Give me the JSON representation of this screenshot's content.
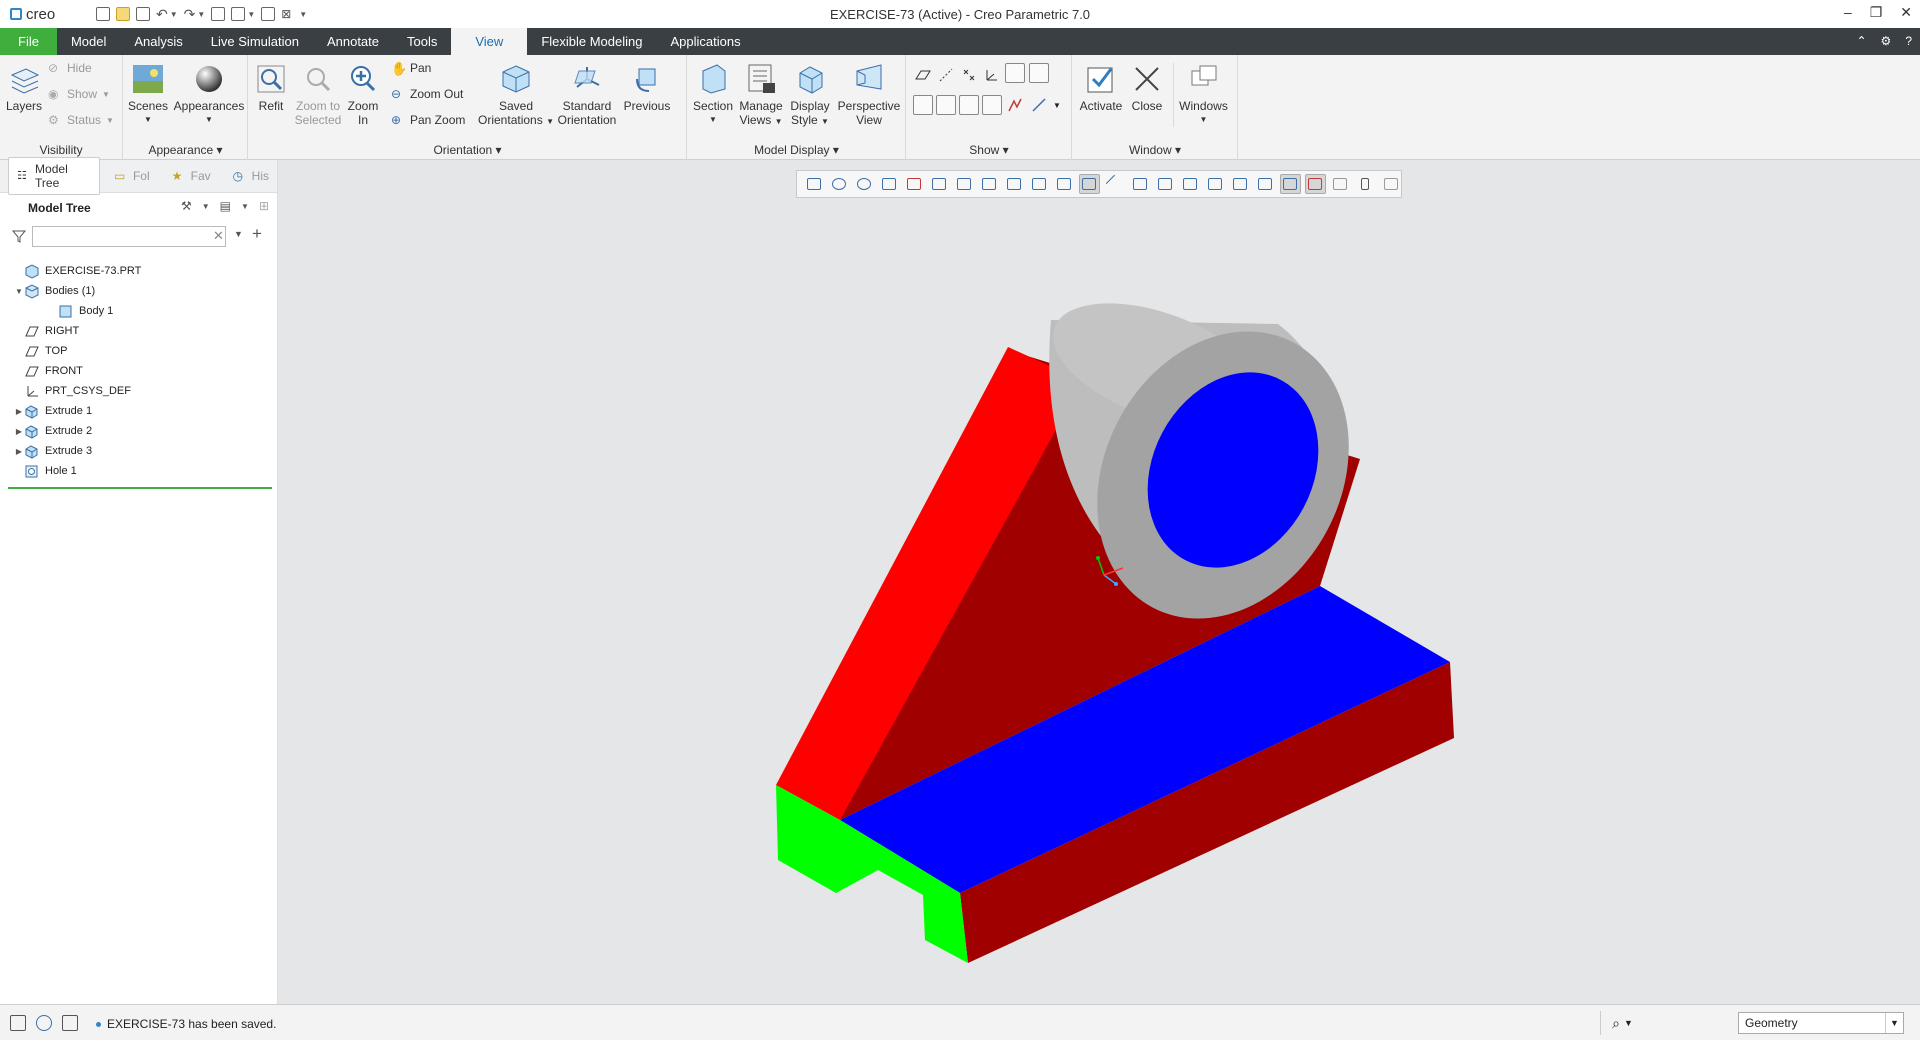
{
  "app": {
    "logo_text": "creo",
    "window_title": "EXERCISE-73 (Active) - Creo Parametric 7.0"
  },
  "menu_tabs": [
    {
      "label": "File"
    },
    {
      "label": "Model"
    },
    {
      "label": "Analysis"
    },
    {
      "label": "Live Simulation"
    },
    {
      "label": "Annotate"
    },
    {
      "label": "Tools"
    },
    {
      "label": "View"
    },
    {
      "label": "Flexible Modeling"
    },
    {
      "label": "Applications"
    }
  ],
  "ribbon": {
    "visibility": {
      "group_label": "Visibility",
      "layers": "Layers",
      "hide": "Hide",
      "show": "Show",
      "status": "Status"
    },
    "appearance": {
      "group_label": "Appearance",
      "scenes": "Scenes",
      "appearances": "Appearances"
    },
    "orientation": {
      "group_label": "Orientation",
      "refit": "Refit",
      "zoom_to_selected_1": "Zoom to",
      "zoom_to_selected_2": "Selected",
      "zoom_in_1": "Zoom",
      "zoom_in_2": "In",
      "pan": "Pan",
      "zoom_out": "Zoom Out",
      "pan_zoom": "Pan Zoom",
      "saved_orientations_1": "Saved",
      "saved_orientations_2": "Orientations",
      "standard_orientation_1": "Standard",
      "standard_orientation_2": "Orientation",
      "previous": "Previous"
    },
    "model_display": {
      "group_label": "Model Display",
      "section": "Section",
      "manage_views_1": "Manage",
      "manage_views_2": "Views",
      "display_style_1": "Display",
      "display_style_2": "Style",
      "perspective_view_1": "Perspective",
      "perspective_view_2": "View"
    },
    "show": {
      "group_label": "Show"
    },
    "window": {
      "group_label": "Window",
      "activate": "Activate",
      "close": "Close",
      "windows": "Windows"
    }
  },
  "panel": {
    "tabs": [
      {
        "label": "Model Tree"
      },
      {
        "label": "Fol"
      },
      {
        "label": "Fav"
      },
      {
        "label": "His"
      }
    ],
    "header": "Model Tree",
    "filter_placeholder": "",
    "tree": [
      {
        "label": "EXERCISE-73.PRT",
        "level": 0,
        "expander": "",
        "icon": "part-icon"
      },
      {
        "label": "Bodies (1)",
        "level": 0,
        "expander": "▼",
        "icon": "bodies-icon"
      },
      {
        "label": "Body 1",
        "level": 1,
        "expander": "",
        "icon": "body-icon"
      },
      {
        "label": "RIGHT",
        "level": 0,
        "expander": "",
        "icon": "datum-plane-icon"
      },
      {
        "label": "TOP",
        "level": 0,
        "expander": "",
        "icon": "datum-plane-icon"
      },
      {
        "label": "FRONT",
        "level": 0,
        "expander": "",
        "icon": "datum-plane-icon"
      },
      {
        "label": "PRT_CSYS_DEF",
        "level": 0,
        "expander": "",
        "icon": "csys-icon"
      },
      {
        "label": "Extrude 1",
        "level": 0,
        "expander": "▶",
        "icon": "extrude-icon"
      },
      {
        "label": "Extrude 2",
        "level": 0,
        "expander": "▶",
        "icon": "extrude-icon"
      },
      {
        "label": "Extrude 3",
        "level": 0,
        "expander": "▶",
        "icon": "extrude-icon"
      },
      {
        "label": "Hole 1",
        "level": 0,
        "expander": "",
        "icon": "hole-icon"
      }
    ]
  },
  "model_colors": {
    "red_faces": "#ff0000",
    "dark_red_faces": "#a00000",
    "blue_faces": "#0000ff",
    "green_faces": "#00ff00",
    "cylinder_gray": "#c4c4c4"
  },
  "status": {
    "message": "EXERCISE-73 has been saved.",
    "filter_value": "Geometry"
  }
}
